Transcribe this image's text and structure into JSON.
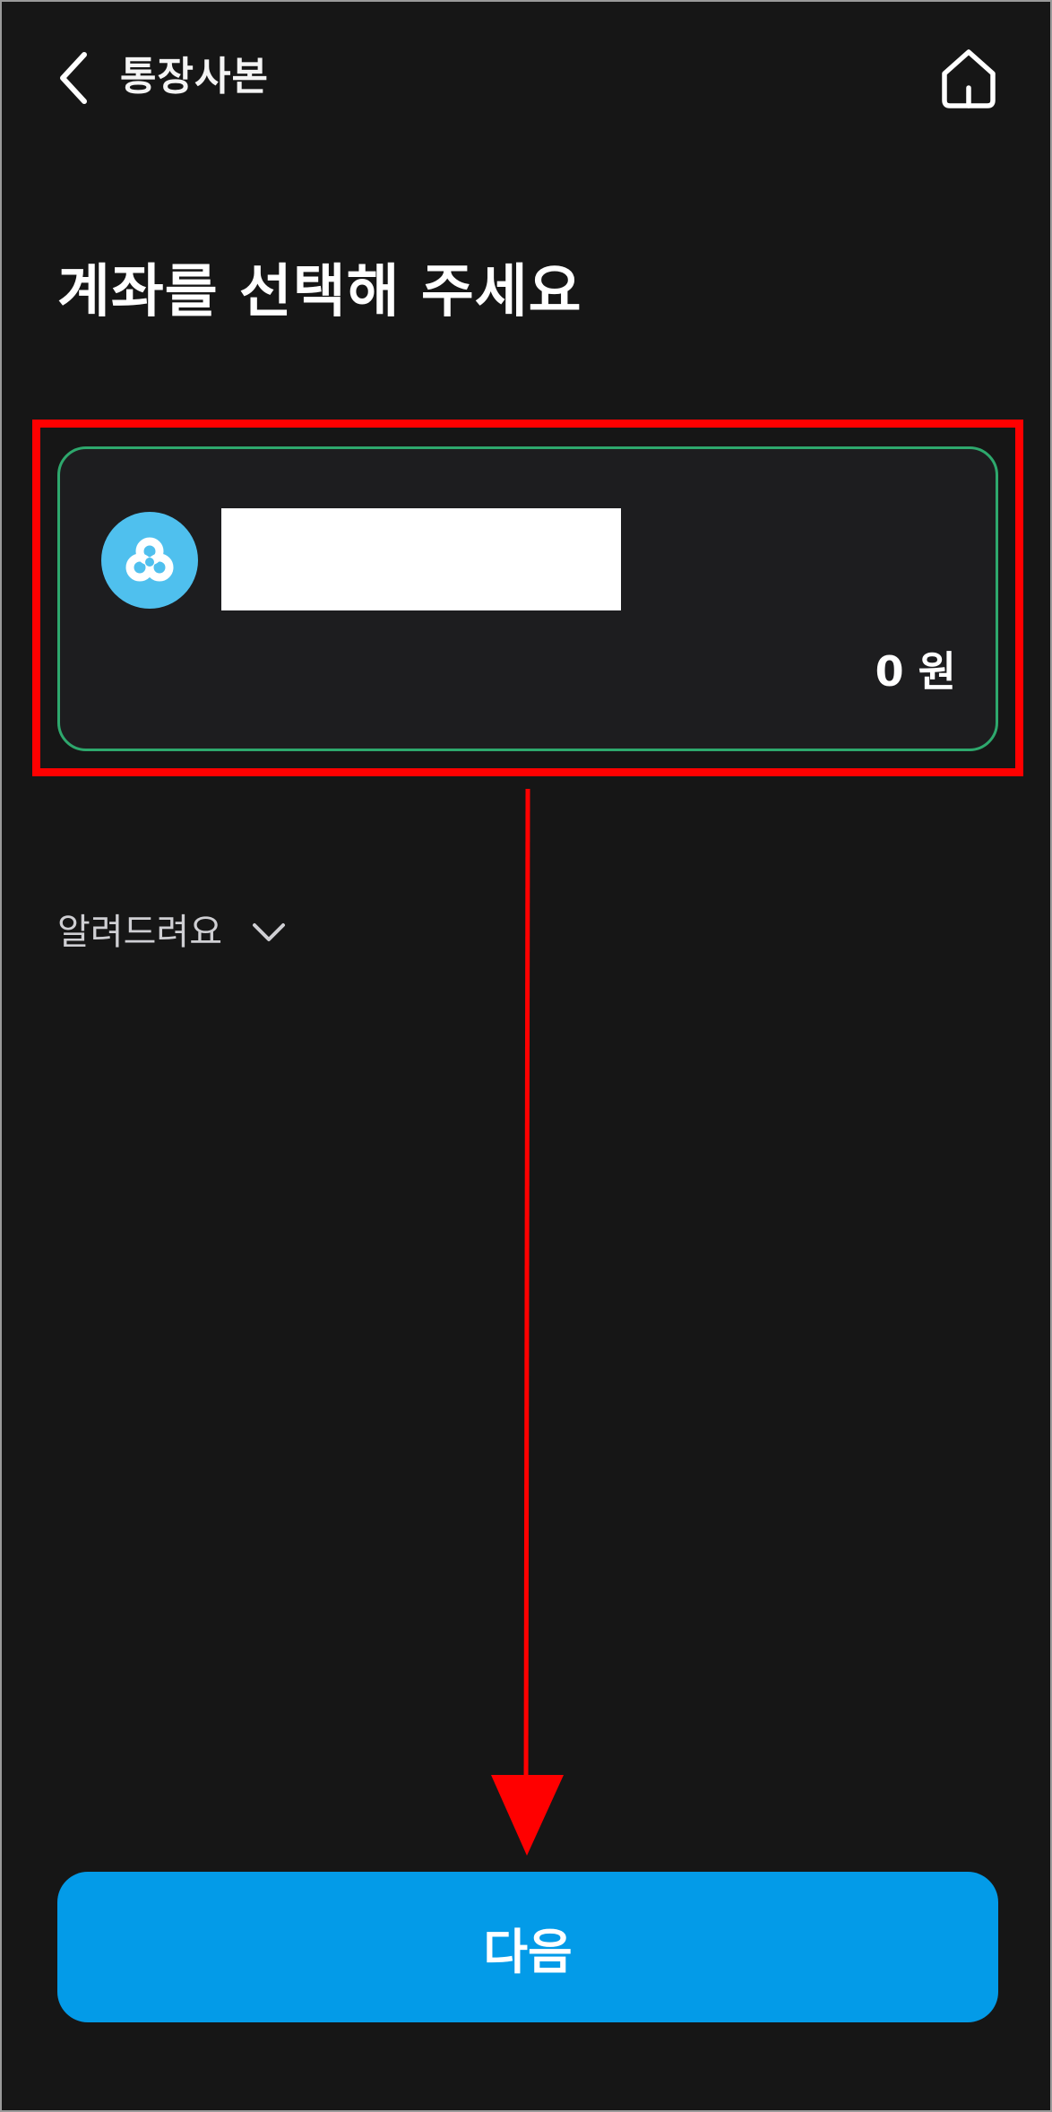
{
  "header": {
    "title": "통장사본",
    "back_icon": "chevron-left-icon",
    "home_icon": "home-icon"
  },
  "main": {
    "title": "계좌를 선택해 주세요",
    "account_card": {
      "bank_logo_icon": "bank-logo-icon",
      "balance": "0 원",
      "selected": true,
      "border_color": "#2ea86d"
    },
    "notice": {
      "label": "알려드려요",
      "icon": "chevron-down-icon"
    }
  },
  "footer": {
    "next_label": "다음",
    "accent_color": "#039be8"
  },
  "annotation": {
    "color": "#ff0000"
  }
}
